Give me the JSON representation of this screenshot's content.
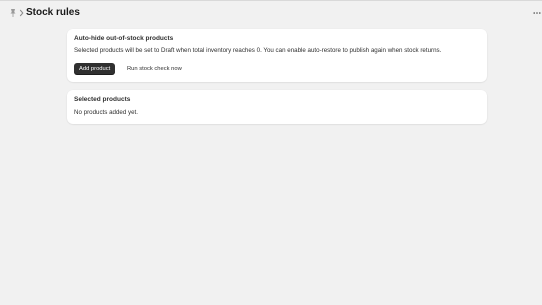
{
  "header": {
    "title": "Stock rules",
    "app_icon": "pin-icon",
    "breadcrumb_icon": "chevron-right-icon",
    "more_icon": "ellipsis-icon"
  },
  "auto_hide_card": {
    "title": "Auto-hide out-of-stock products",
    "description": "Selected products will be set to Draft when total inventory reaches 0. You can enable auto-restore to publish again when stock returns.",
    "add_product_label": "Add product",
    "run_check_label": "Run stock check now"
  },
  "selected_card": {
    "title": "Selected products",
    "empty_text": "No products added yet."
  },
  "colors": {
    "background": "#f1f1f1",
    "card": "#ffffff",
    "primary_button": "#303030",
    "text": "#303030"
  }
}
